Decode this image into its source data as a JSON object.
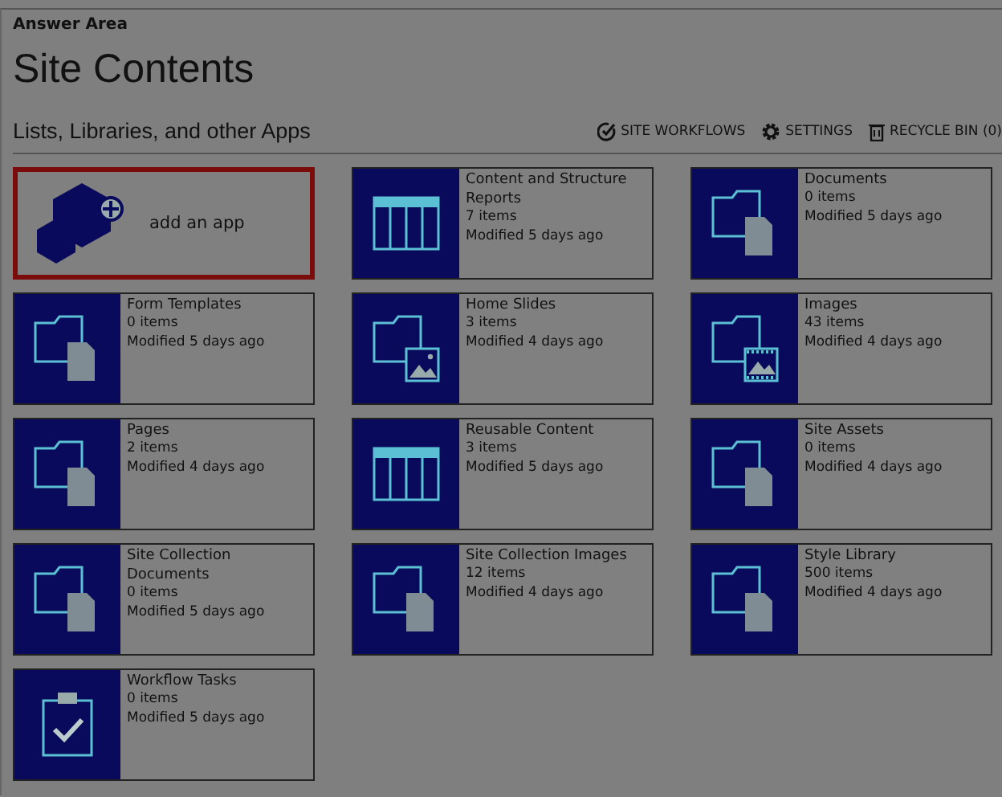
{
  "heading": "Answer Area",
  "title": "Site Contents",
  "section_title": "Lists, Libraries, and other Apps",
  "actions": [
    {
      "kind": "workflows",
      "label": "SITE WORKFLOWS"
    },
    {
      "kind": "settings",
      "label": "SETTINGS"
    },
    {
      "kind": "recycle",
      "label": "RECYCLE BIN (0)"
    }
  ],
  "tiles": [
    {
      "kind": "add",
      "title": "add an app",
      "selected": true
    },
    {
      "kind": "table",
      "title": "Content and Structure Reports",
      "count": "7 items",
      "modified": "Modified 5 days ago",
      "selected": false
    },
    {
      "kind": "folder",
      "title": "Documents",
      "count": "0 items",
      "modified": "Modified 5 days ago",
      "selected": false
    },
    {
      "kind": "folder",
      "title": "Form Templates",
      "count": "0 items",
      "modified": "Modified 5 days ago",
      "selected": false
    },
    {
      "kind": "folder-image",
      "title": "Home Slides",
      "count": "3 items",
      "modified": "Modified 4 days ago",
      "selected": false
    },
    {
      "kind": "folder-film",
      "title": "Images",
      "count": "43 items",
      "modified": "Modified 4 days ago",
      "selected": false
    },
    {
      "kind": "folder",
      "title": "Pages",
      "count": "2 items",
      "modified": "Modified 4 days ago",
      "selected": false
    },
    {
      "kind": "table",
      "title": "Reusable Content",
      "count": "3 items",
      "modified": "Modified 5 days ago",
      "selected": false
    },
    {
      "kind": "folder",
      "title": "Site Assets",
      "count": "0 items",
      "modified": "Modified 4 days ago",
      "selected": false
    },
    {
      "kind": "folder",
      "title": "Site Collection Documents",
      "count": "0 items",
      "modified": "Modified 5 days ago",
      "selected": false
    },
    {
      "kind": "folder",
      "title": "Site Collection Images",
      "count": "12 items",
      "modified": "Modified 4 days ago",
      "selected": false
    },
    {
      "kind": "folder",
      "title": "Style Library",
      "count": "500 items",
      "modified": "Modified 4 days ago",
      "selected": false
    },
    {
      "kind": "tasks",
      "title": "Workflow Tasks",
      "count": "0 items",
      "modified": "Modified 5 days ago",
      "selected": false
    }
  ]
}
